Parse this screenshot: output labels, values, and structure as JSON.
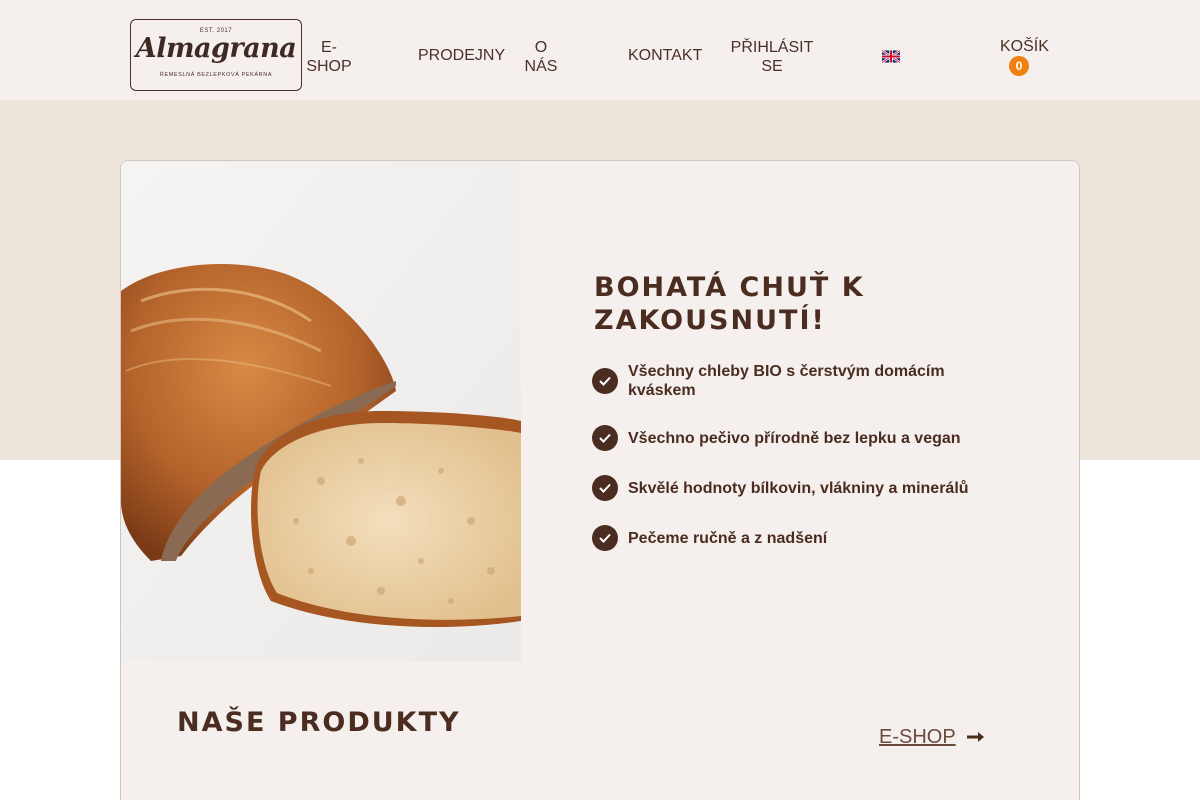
{
  "header": {
    "logo": {
      "est": "EST. 2017",
      "name": "Almagrana",
      "tagline": "ŘEMESLNÁ BEZLEPKOVÁ PEKÁRNA"
    },
    "nav": {
      "eshop": "E-SHOP",
      "prodejny": "PRODEJNY",
      "onas": "O NÁS",
      "kontakt": "KONTAKT",
      "login": "PŘIHLÁSIT SE"
    },
    "language_icon": "uk-flag-icon",
    "cart": {
      "label": "KOŠÍK",
      "count": "0"
    }
  },
  "hero": {
    "title": "BOHATÁ CHUŤ K ZAKOUSNUTÍ!",
    "features": [
      "Všechny chleby BIO s čerstvým domácím kváskem",
      "Všechno pečivo přírodně bez lepku a vegan",
      "Skvělé hodnoty bílkovin, vlákniny a minerálů",
      "Pečeme ručně a z nadšení"
    ],
    "check_icon": "check-circle-icon"
  },
  "products": {
    "title": "NAŠE PRODUKTY",
    "link": "E-SHOP",
    "link_icon": "arrow-right-icon"
  },
  "colors": {
    "brand_brown": "#4a2c20",
    "accent_orange": "#f0800f",
    "header_bg": "#f5f0ed",
    "hero_band": "#ede4dc"
  }
}
